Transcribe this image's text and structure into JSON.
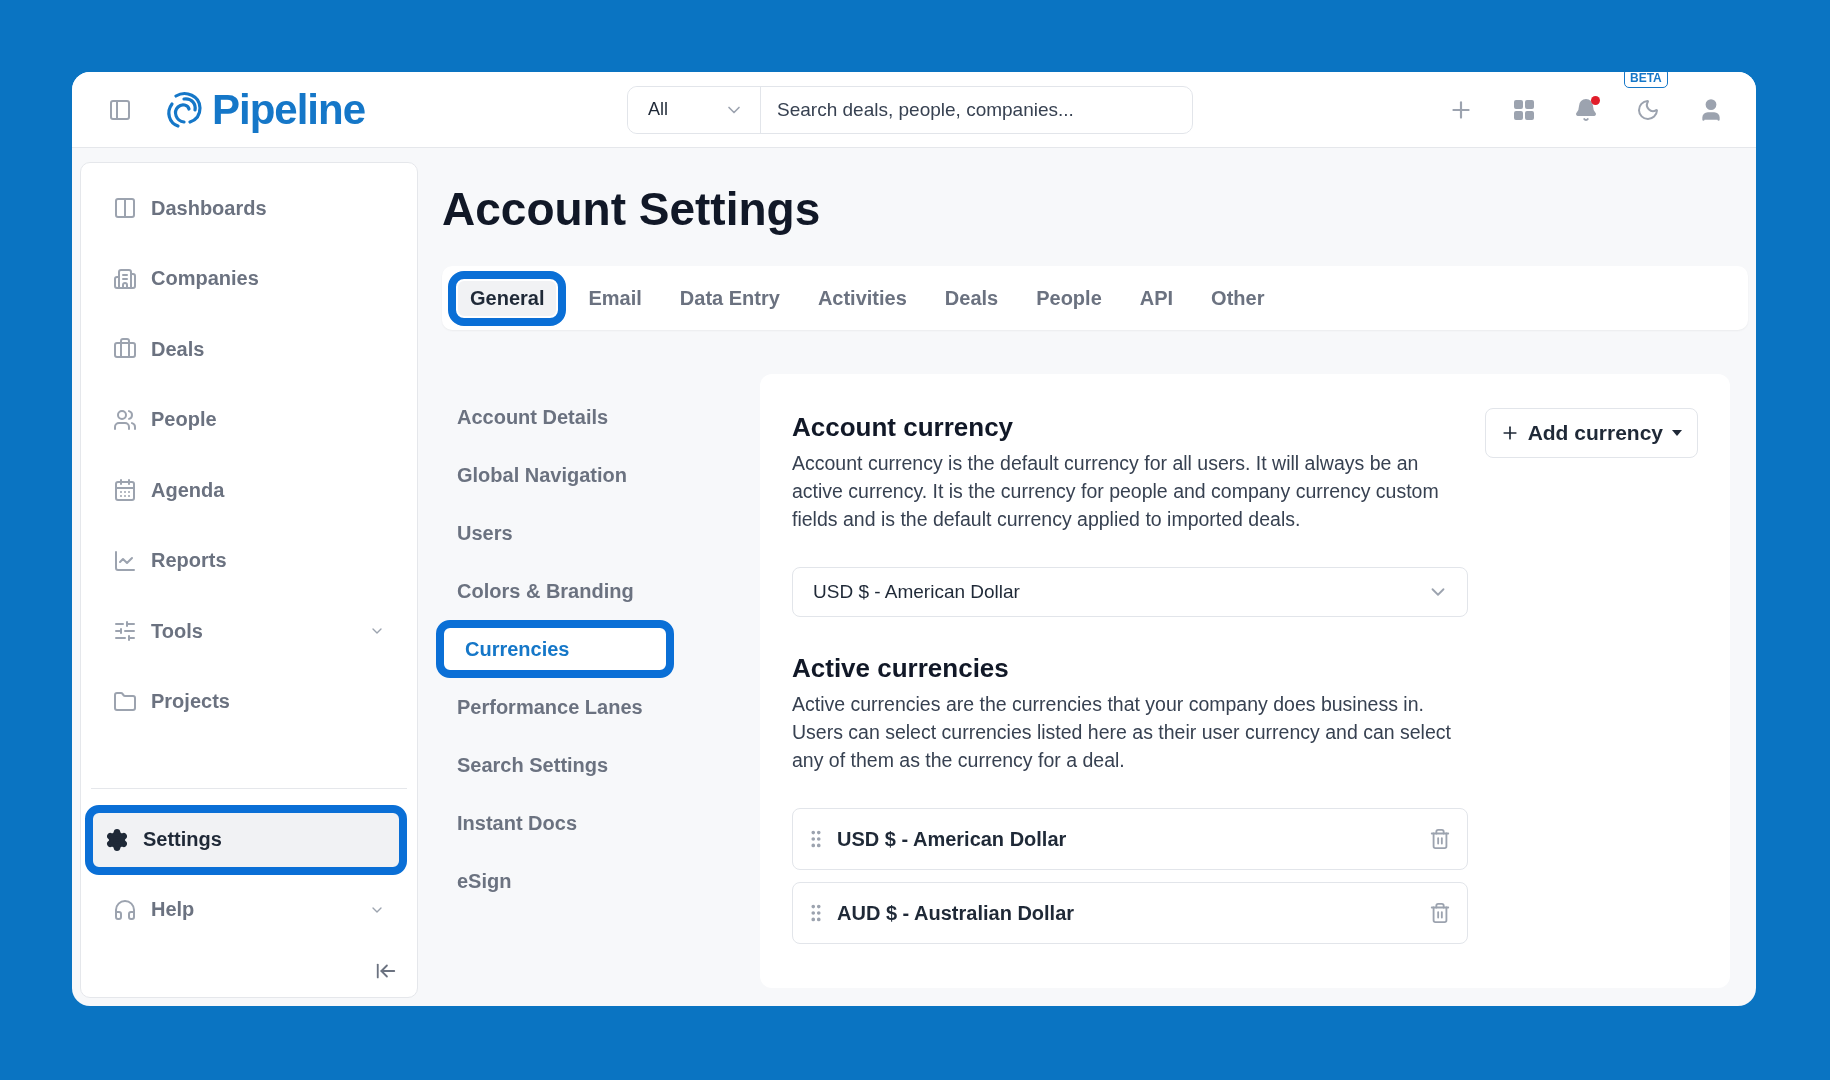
{
  "header": {
    "logo": "Pipeline",
    "search_scope": "All",
    "search": {
      "placeholder": "Search deals, people, companies..."
    },
    "beta_badge": "BETA",
    "notifications_unread": true
  },
  "sidebar": {
    "items": [
      {
        "label": "Dashboards",
        "kind": "link",
        "selected": false
      },
      {
        "label": "Companies",
        "kind": "link",
        "selected": false
      },
      {
        "label": "Deals",
        "kind": "link",
        "selected": false
      },
      {
        "label": "People",
        "kind": "link",
        "selected": false
      },
      {
        "label": "Agenda",
        "kind": "link",
        "selected": false
      },
      {
        "label": "Reports",
        "kind": "link",
        "selected": false
      },
      {
        "label": "Tools",
        "kind": "group",
        "selected": false
      },
      {
        "label": "Projects",
        "kind": "link",
        "selected": false
      }
    ],
    "bottom_items": [
      {
        "label": "Settings",
        "kind": "link",
        "selected": true
      },
      {
        "label": "Help",
        "kind": "group",
        "selected": false
      }
    ]
  },
  "page": {
    "title": "Account Settings",
    "tabs": [
      {
        "label": "General",
        "selected": true
      },
      {
        "label": "Email",
        "selected": false
      },
      {
        "label": "Data Entry",
        "selected": false
      },
      {
        "label": "Activities",
        "selected": false
      },
      {
        "label": "Deals",
        "selected": false
      },
      {
        "label": "People",
        "selected": false
      },
      {
        "label": "API",
        "selected": false
      },
      {
        "label": "Other",
        "selected": false
      }
    ],
    "subnav": [
      {
        "label": "Account Details",
        "selected": false
      },
      {
        "label": "Global Navigation",
        "selected": false
      },
      {
        "label": "Users",
        "selected": false
      },
      {
        "label": "Colors & Branding",
        "selected": false
      },
      {
        "label": "Currencies",
        "selected": true
      },
      {
        "label": "Performance Lanes",
        "selected": false
      },
      {
        "label": "Search Settings",
        "selected": false
      },
      {
        "label": "Instant Docs",
        "selected": false
      },
      {
        "label": "eSign",
        "selected": false
      }
    ],
    "account_currency": {
      "heading": "Account currency",
      "description": "Account currency is the default currency for all users. It will always be an active currency. It is the currency for people and company currency custom fields and is the default currency applied to imported deals.",
      "value": "USD $ - American Dollar"
    },
    "add_currency_button": "Add currency",
    "active_currencies": {
      "heading": "Active currencies",
      "description": "Active currencies are the currencies that your company does business in. Users can select currencies listed here as their user currency and can select any of them as the currency for a deal.",
      "items": [
        "USD $ - American Dollar",
        "AUD $ - Australian Dollar"
      ]
    }
  }
}
